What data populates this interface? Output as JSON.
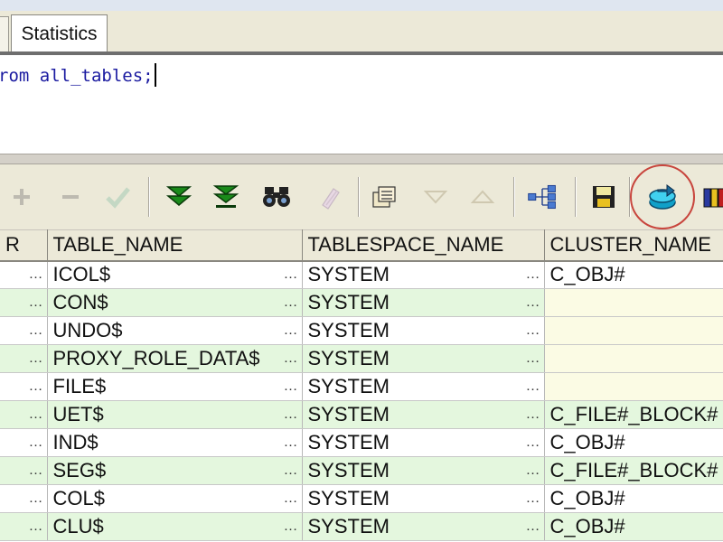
{
  "tabs": {
    "active_label": "Statistics"
  },
  "editor": {
    "sql_text": "rom all_tables;"
  },
  "toolbar": {
    "buttons": [
      "add-record-icon",
      "delete-record-icon",
      "post-edit-icon",
      "fetch-next-icon",
      "fetch-all-icon",
      "find-icon",
      "clear-icon",
      "query-by-example-icon",
      "sort-descending-icon",
      "sort-ascending-icon",
      "explain-plan-icon",
      "save-icon",
      "export-icon",
      "view-icon"
    ],
    "highlight_color": "#c8453d"
  },
  "grid": {
    "columns": [
      "R",
      "TABLE_NAME",
      "TABLESPACE_NAME",
      "CLUSTER_NAME"
    ],
    "cell_button": "…",
    "rows": [
      {
        "table_name": "ICOL$",
        "tablespace_name": "SYSTEM",
        "cluster_name": "C_OBJ#"
      },
      {
        "table_name": "CON$",
        "tablespace_name": "SYSTEM",
        "cluster_name": ""
      },
      {
        "table_name": "UNDO$",
        "tablespace_name": "SYSTEM",
        "cluster_name": ""
      },
      {
        "table_name": "PROXY_ROLE_DATA$",
        "tablespace_name": "SYSTEM",
        "cluster_name": ""
      },
      {
        "table_name": "FILE$",
        "tablespace_name": "SYSTEM",
        "cluster_name": ""
      },
      {
        "table_name": "UET$",
        "tablespace_name": "SYSTEM",
        "cluster_name": "C_FILE#_BLOCK#"
      },
      {
        "table_name": "IND$",
        "tablespace_name": "SYSTEM",
        "cluster_name": "C_OBJ#"
      },
      {
        "table_name": "SEG$",
        "tablespace_name": "SYSTEM",
        "cluster_name": "C_FILE#_BLOCK#"
      },
      {
        "table_name": "COL$",
        "tablespace_name": "SYSTEM",
        "cluster_name": "C_OBJ#"
      },
      {
        "table_name": "CLU$",
        "tablespace_name": "SYSTEM",
        "cluster_name": "C_OBJ#"
      }
    ],
    "even_row_color": "#e4f7de",
    "empty_cell_color": "#fbfbe4"
  }
}
